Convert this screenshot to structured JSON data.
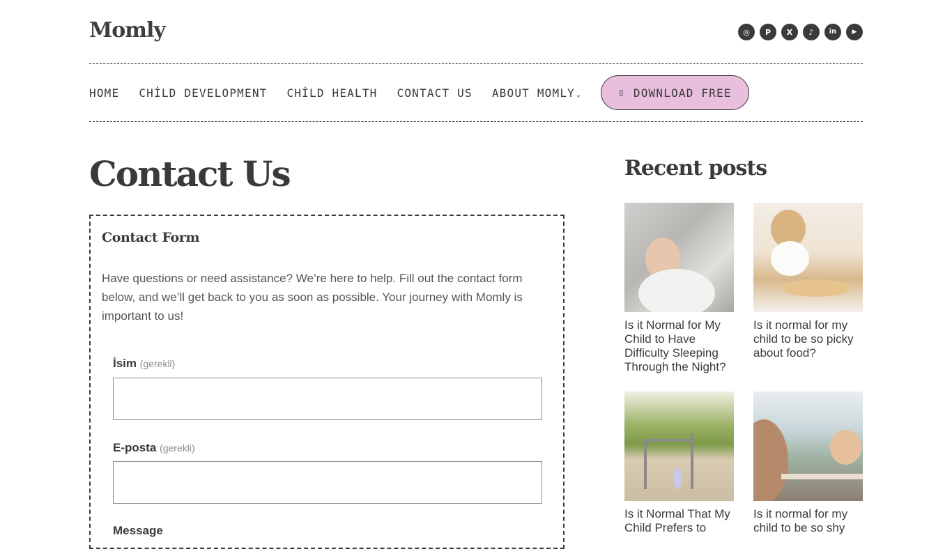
{
  "site": {
    "logo": "Momly"
  },
  "social": [
    {
      "name": "instagram-icon",
      "glyph": "◎"
    },
    {
      "name": "pinterest-icon",
      "glyph": "P"
    },
    {
      "name": "x-icon",
      "glyph": "X"
    },
    {
      "name": "tiktok-icon",
      "glyph": "♪"
    },
    {
      "name": "linkedin-icon",
      "glyph": "in"
    },
    {
      "name": "youtube-icon",
      "glyph": "▶"
    }
  ],
  "nav": {
    "home": "HOME",
    "child_development": "CHİLD DEVELOPMENT",
    "child_health": "CHİLD HEALTH",
    "contact_us": "CONTACT US",
    "about_momly": "ABOUT MOMLY",
    "download": "DOWNLOAD FREE",
    "download_icon": "▯",
    "chevron": "⌄"
  },
  "page": {
    "title": "Contact Us"
  },
  "form": {
    "heading": "Contact Form",
    "intro": "Have questions or need assistance? We’re here to help. Fill out the contact form below, and we’ll get back to you as soon as possible. Your journey with Momly is important to us!",
    "name_label": "İsim",
    "name_required": "(gerekli)",
    "name_value": "",
    "email_label": "E-posta",
    "email_required": "(gerekli)",
    "email_value": "",
    "message_label": "Message"
  },
  "sidebar": {
    "title": "Recent posts",
    "posts": [
      {
        "title": "Is it Normal for My Child to Have Difficulty Sleeping Through the Night?"
      },
      {
        "title": "Is it normal for my child to be so picky about food?"
      },
      {
        "title": "Is it Normal That My Child Prefers to"
      },
      {
        "title": "Is it normal for my child to be so shy"
      }
    ]
  },
  "colors": {
    "accent": "#e8bfdc",
    "text": "#3a3a3a"
  }
}
